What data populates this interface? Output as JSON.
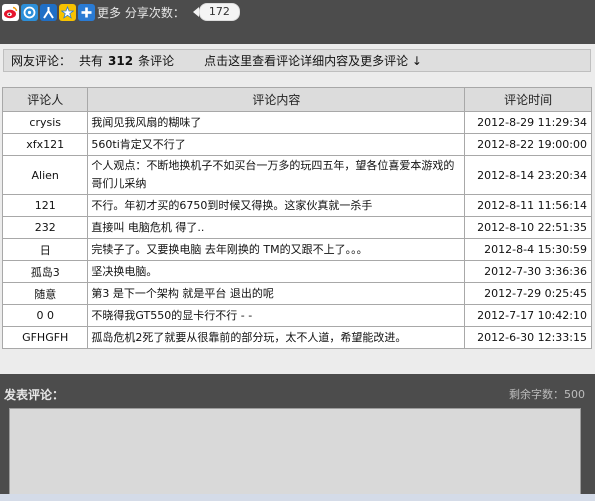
{
  "share": {
    "icons": [
      "weibo-icon",
      "qzone-icon",
      "renren-icon",
      "kaixin-icon",
      "more-plus-icon"
    ],
    "more_label": "更多 分享次数：",
    "count": "172"
  },
  "summary": {
    "label": "网友评论：",
    "count_prefix": "共有",
    "count": "312",
    "count_suffix": "条评论",
    "link": "点击这里查看评论详细内容及更多评论 ↓"
  },
  "table": {
    "headers": [
      "评论人",
      "评论内容",
      "评论时间"
    ],
    "rows": [
      {
        "user": "crysis",
        "content": "我闻见我风扇的糊味了",
        "time": "2012-8-29 11:29:34"
      },
      {
        "user": "xfx121",
        "content": "560ti肯定又不行了",
        "time": "2012-8-22 19:00:00"
      },
      {
        "user": "Alien",
        "content": "个人观点：不断地换机子不如买台一万多的玩四五年，望各位喜爱本游戏的哥们儿采纳",
        "time": "2012-8-14 23:20:34"
      },
      {
        "user": "121",
        "content": "不行。年初才买的6750到时候又得换。这家伙真就一杀手",
        "time": "2012-8-11 11:56:14"
      },
      {
        "user": "232",
        "content": "直接叫 电脑危机 得了..",
        "time": "2012-8-10 22:51:35"
      },
      {
        "user": "日",
        "content": "完犊子了。又要换电脑 去年刚换的 TM的又跟不上了。。。",
        "time": "2012-8-4 15:30:59"
      },
      {
        "user": "孤岛3",
        "content": "坚决换电脑。",
        "time": "2012-7-30 3:36:36"
      },
      {
        "user": "随意",
        "content": "第3  是下一个架构 就是平台 退出的呢",
        "time": "2012-7-29 0:25:45"
      },
      {
        "user": "0 0",
        "content": "不晓得我GT550的显卡行不行 - -",
        "time": "2012-7-17 10:42:10"
      },
      {
        "user": "GFHGFH",
        "content": "孤岛危机2死了就要从很靠前的部分玩，太不人道，希望能改进。",
        "time": "2012-6-30 12:33:15"
      }
    ]
  },
  "post": {
    "title": "发表评论：",
    "remaining": "剩余字数：500"
  }
}
